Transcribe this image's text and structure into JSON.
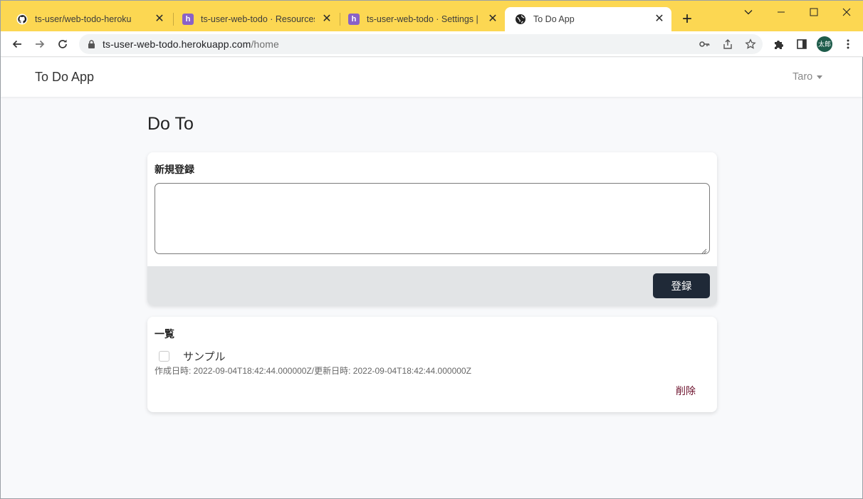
{
  "browser": {
    "tabs": [
      {
        "title": "ts-user/web-todo-heroku",
        "icon": "github-icon"
      },
      {
        "title": "ts-user-web-todo · Resources | He",
        "icon": "heroku-icon"
      },
      {
        "title": "ts-user-web-todo · Settings | He",
        "icon": "heroku-icon"
      },
      {
        "title": "To Do App",
        "icon": "globe-icon",
        "active": true
      }
    ],
    "url_host": "ts-user-web-todo.herokuapp.com",
    "url_path": "/home",
    "profile_initials": "太郎",
    "accent_color": "#fcd752"
  },
  "nav": {
    "brand": "To Do App",
    "user": "Taro"
  },
  "page": {
    "title": "Do To",
    "new_card": {
      "heading": "新規登録",
      "textarea_value": "",
      "submit_label": "登録"
    },
    "list_card": {
      "heading": "一覧",
      "items": [
        {
          "text": "サンプル",
          "done": false,
          "meta": "作成日時: 2022-09-04T18:42:44.000000Z/更新日時: 2022-09-04T18:42:44.000000Z",
          "delete_label": "削除"
        }
      ]
    }
  }
}
